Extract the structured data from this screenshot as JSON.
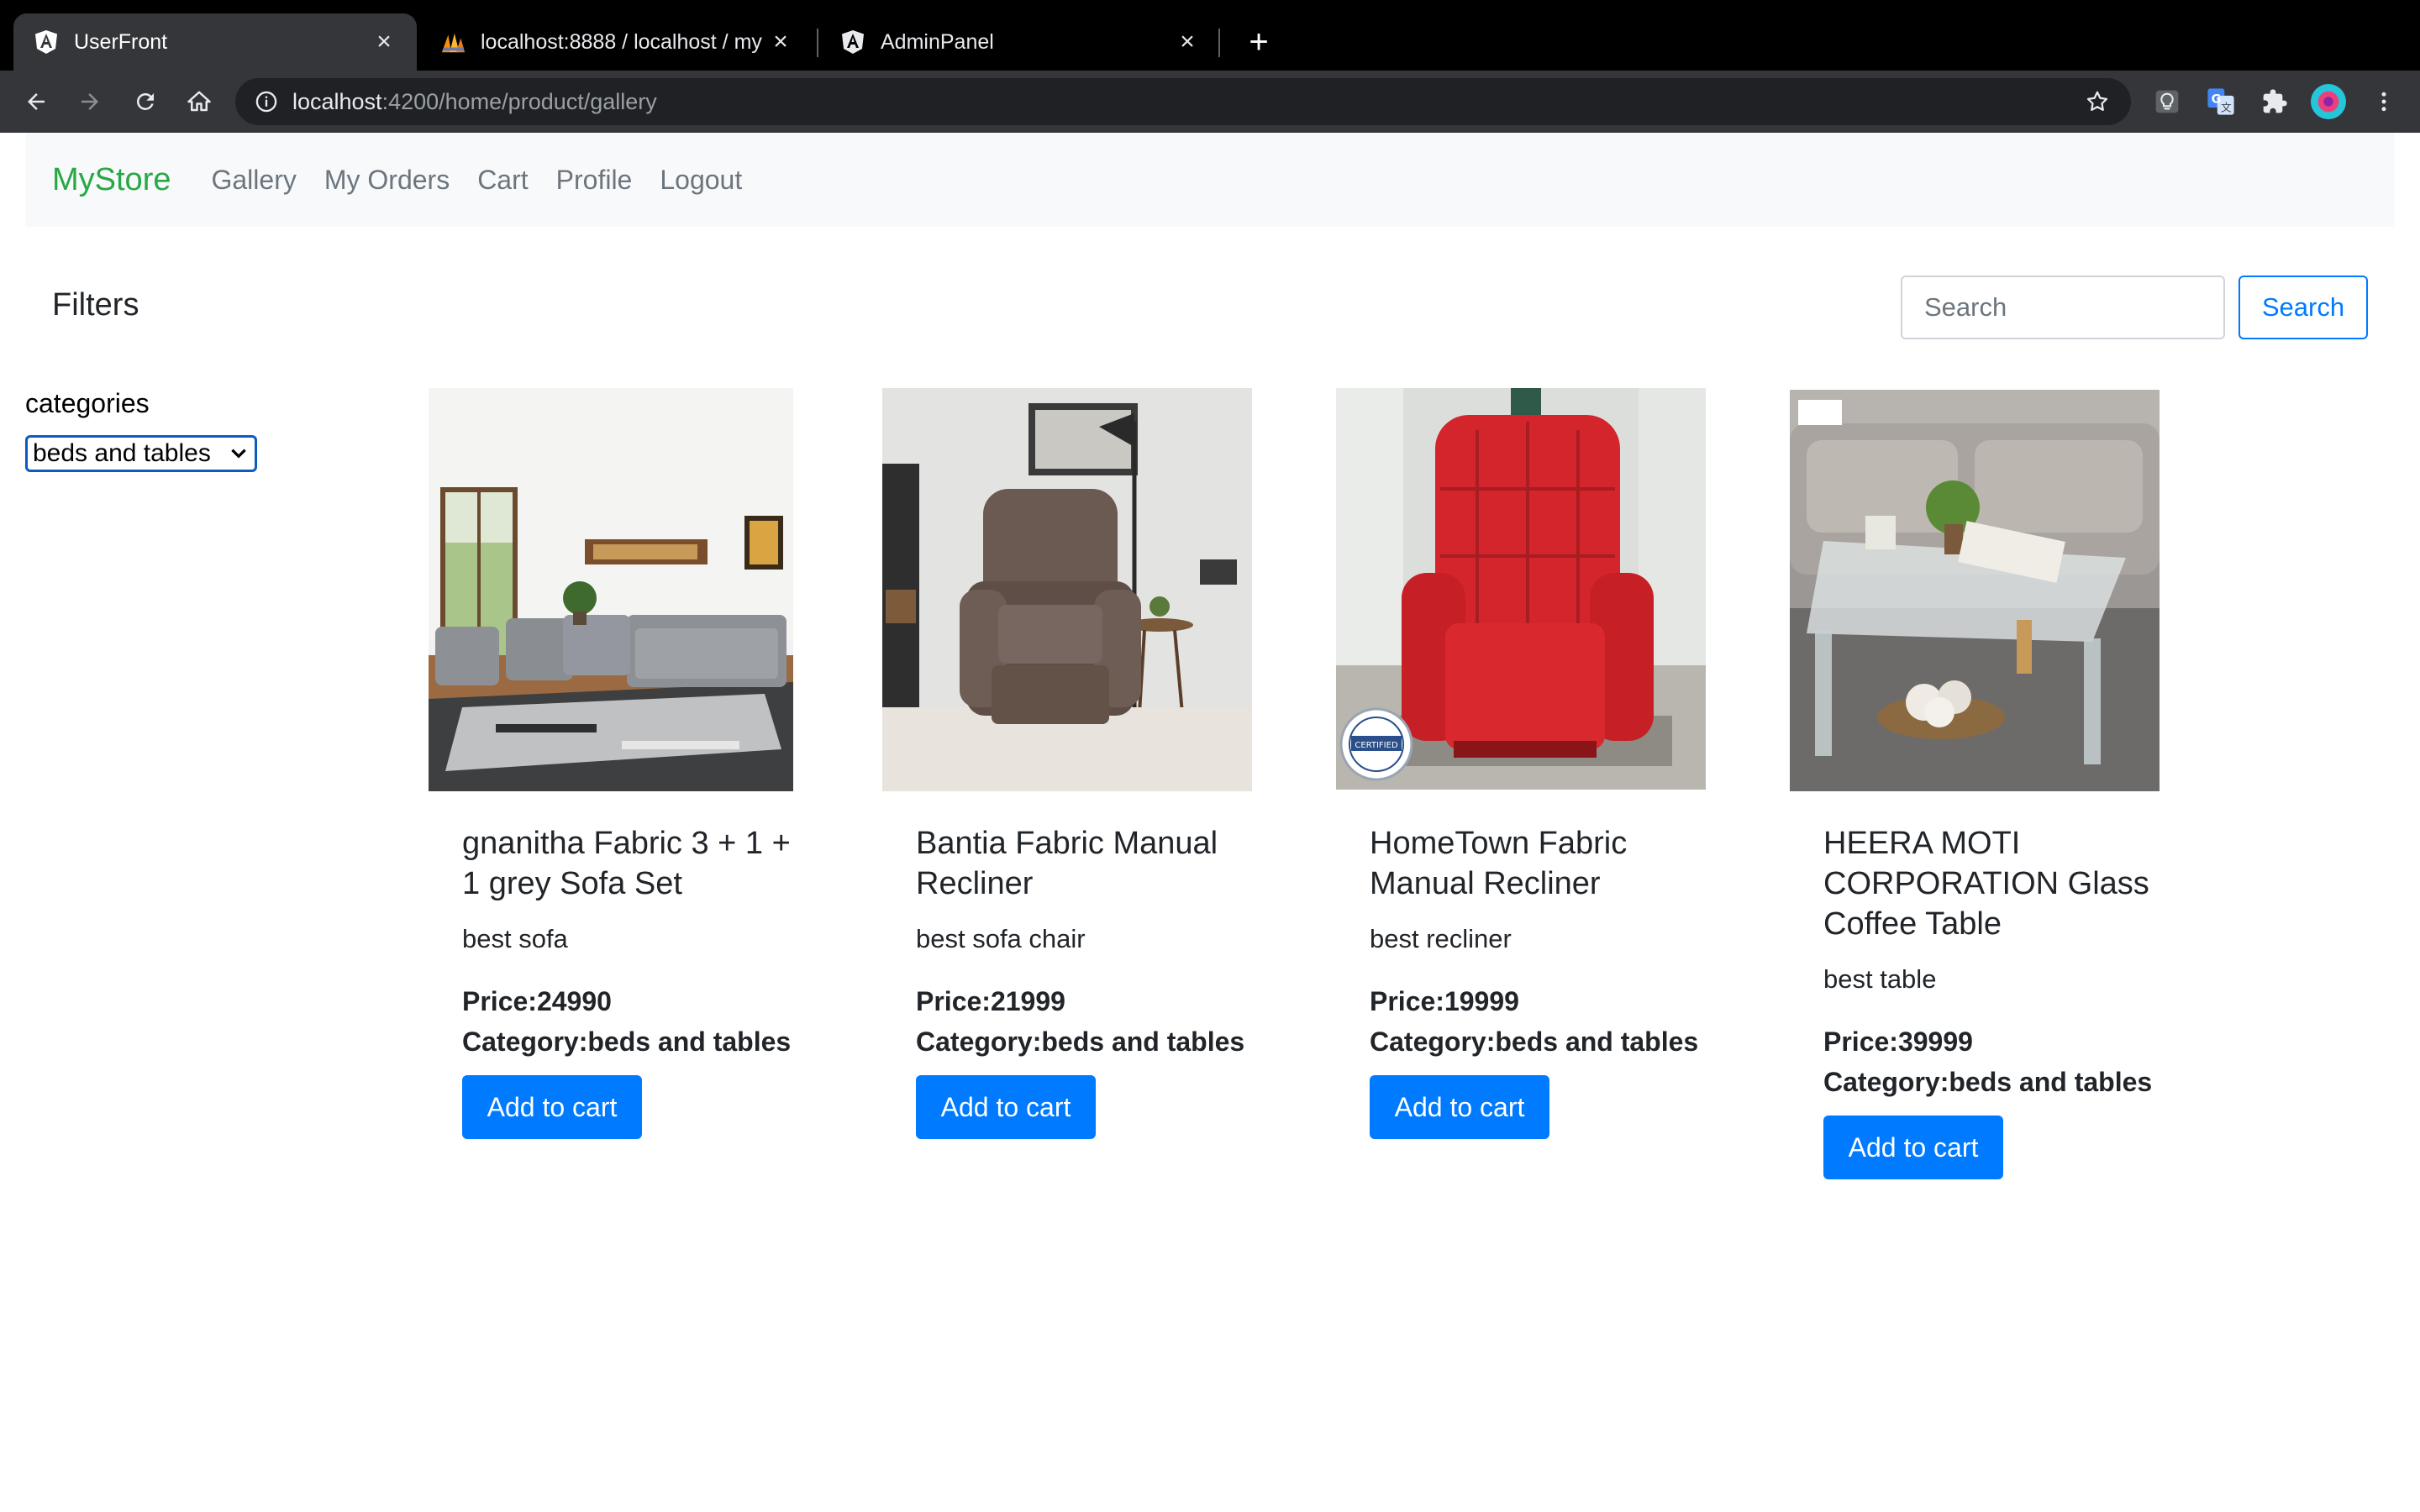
{
  "browser": {
    "tabs": [
      {
        "title": "UserFront",
        "active": true
      },
      {
        "title": "localhost:8888 / localhost / my",
        "active": false
      },
      {
        "title": "AdminPanel",
        "active": false
      }
    ],
    "url_host": "localhost",
    "url_path": ":4200/home/product/gallery"
  },
  "nav": {
    "brand": "MyStore",
    "links": [
      "Gallery",
      "My Orders",
      "Cart",
      "Profile",
      "Logout"
    ]
  },
  "filters": {
    "title": "Filters",
    "categories_label": "categories",
    "selected_category": "beds and tables"
  },
  "search": {
    "placeholder": "Search",
    "button": "Search"
  },
  "products": [
    {
      "name": "gnanitha Fabric 3 + 1 + 1 grey Sofa Set",
      "description": "best sofa",
      "price": "Price:24990",
      "category": "Category:beds and tables",
      "button": "Add to cart"
    },
    {
      "name": "Bantia Fabric Manual Recliner",
      "description": "best sofa chair",
      "price": "Price:21999",
      "category": "Category:beds and tables",
      "button": "Add to cart"
    },
    {
      "name": "HomeTown Fabric Manual Recliner",
      "description": "best recliner",
      "price": "Price:19999",
      "category": "Category:beds and tables",
      "button": "Add to cart"
    },
    {
      "name": "HEERA MOTI CORPORATION Glass Coffee Table",
      "description": "best table",
      "price": "Price:39999",
      "category": "Category:beds and tables",
      "button": "Add to cart"
    }
  ],
  "colors": {
    "brand": "#28a745",
    "primary": "#007bff",
    "navbar_bg": "#f8f9fa"
  }
}
